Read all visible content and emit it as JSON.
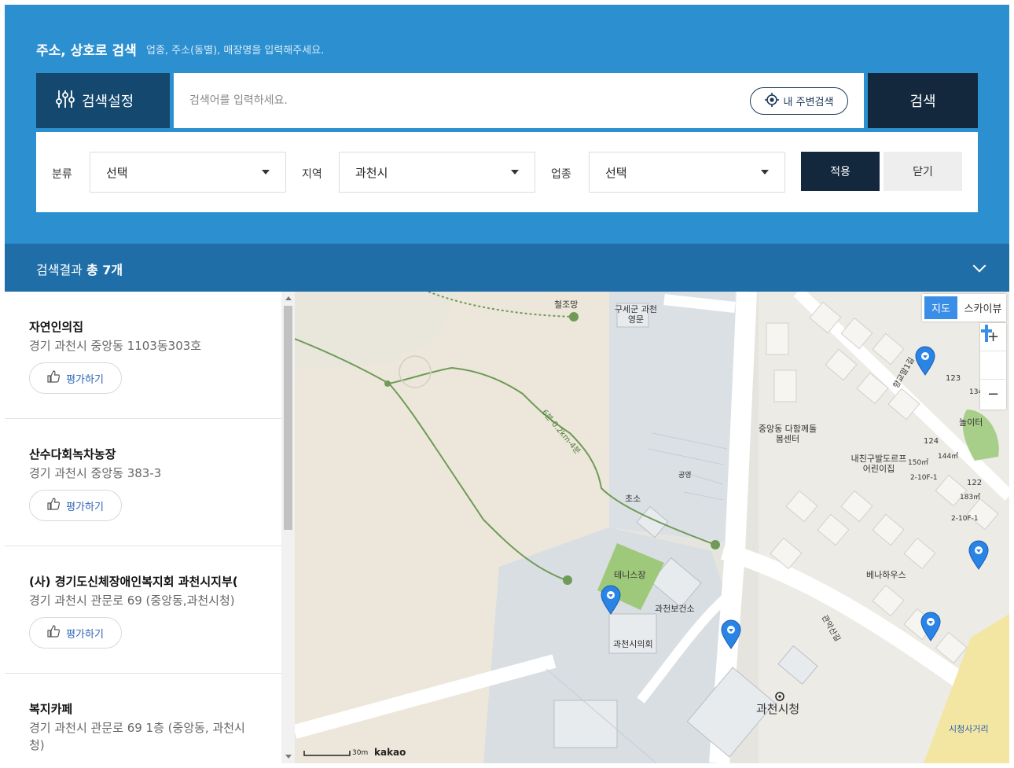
{
  "search": {
    "heading": "주소, 상호로 검색",
    "hint": "업종, 주소(동별), 매장명을 입력해주세요.",
    "settings_label": "검색설정",
    "placeholder": "검색어를 입력하세요.",
    "nearby_label": "내 주변검색",
    "button_label": "검색"
  },
  "filters": {
    "category_label": "분류",
    "category_value": "선택",
    "region_label": "지역",
    "region_value": "과천시",
    "business_label": "업종",
    "business_value": "선택",
    "apply_label": "적용",
    "close_label": "닫기"
  },
  "results": {
    "prefix": "검색결과",
    "count_text": "총 7개",
    "rate_label": "평가하기",
    "items": [
      {
        "name": "자연인의집",
        "address": "경기 과천시 중앙동 1103동303호"
      },
      {
        "name": "산수다회녹차농장",
        "address": "경기 과천시 중앙동 383-3"
      },
      {
        "name": "(사) 경기도신체장애인복지회 과천시지부(",
        "address": "경기 과천시 관문로 69 (중앙동,과천시청)"
      },
      {
        "name": "복지카페",
        "address": "경기 과천시 관문로 69 1층 (중앙동, 과천시청)"
      }
    ]
  },
  "map": {
    "type_map": "지도",
    "type_sky": "스카이뷰",
    "zoom_in": "+",
    "zoom_out": "−",
    "scale": "30m",
    "brand": "kakao",
    "marker_color": "#2a84e6",
    "labels": {
      "l1": "철조망",
      "l2": "구세군 과천영문",
      "l3": "중앙동 다함께돌봄센터",
      "l4": "내친구발도르프 어린이집",
      "l5": "초소",
      "l6": "공영",
      "l7": "테니스장",
      "l8": "과천보건소",
      "l9": "과천시의회",
      "l10": "과천시청",
      "l11": "베나하우스",
      "l12": "놀이터",
      "l13": "시청사거리",
      "l14": "123",
      "l15": "124",
      "l16": "122",
      "l17": "2-10F-1",
      "l18": "2-10F-1",
      "l19": "150㎡",
      "l20": "144㎡",
      "l21": "183㎡",
      "l22": "134㎡",
      "l23": "향교말1길",
      "l24": "관악산길",
      "l25": "6분-0.2km-4분"
    }
  }
}
